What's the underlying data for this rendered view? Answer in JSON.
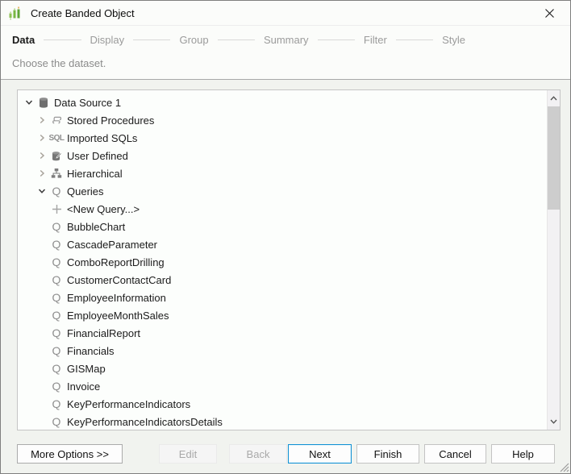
{
  "window": {
    "title": "Create Banded Object"
  },
  "wizard": {
    "steps": [
      {
        "label": "Data",
        "active": true
      },
      {
        "label": "Display",
        "active": false
      },
      {
        "label": "Group",
        "active": false
      },
      {
        "label": "Summary",
        "active": false
      },
      {
        "label": "Filter",
        "active": false
      },
      {
        "label": "Style",
        "active": false
      }
    ],
    "description": "Choose the dataset."
  },
  "tree": {
    "rows": [
      {
        "level": 0,
        "chevron": "expanded",
        "icon": "database",
        "label": "Data Source 1"
      },
      {
        "level": 1,
        "chevron": "collapsed",
        "icon": "stored-procedure",
        "label": "Stored Procedures"
      },
      {
        "level": 1,
        "chevron": "collapsed",
        "icon": "sql",
        "label": "Imported SQLs"
      },
      {
        "level": 1,
        "chevron": "collapsed",
        "icon": "user-defined",
        "label": "User Defined"
      },
      {
        "level": 1,
        "chevron": "collapsed",
        "icon": "hierarchy",
        "label": "Hierarchical"
      },
      {
        "level": 1,
        "chevron": "expanded",
        "icon": "query",
        "label": "Queries"
      },
      {
        "level": 2,
        "chevron": null,
        "icon": "plus",
        "label": "<New Query...>"
      },
      {
        "level": 2,
        "chevron": null,
        "icon": "query",
        "label": "BubbleChart"
      },
      {
        "level": 2,
        "chevron": null,
        "icon": "query",
        "label": "CascadeParameter"
      },
      {
        "level": 2,
        "chevron": null,
        "icon": "query",
        "label": "ComboReportDrilling"
      },
      {
        "level": 2,
        "chevron": null,
        "icon": "query",
        "label": "CustomerContactCard"
      },
      {
        "level": 2,
        "chevron": null,
        "icon": "query",
        "label": "EmployeeInformation"
      },
      {
        "level": 2,
        "chevron": null,
        "icon": "query",
        "label": "EmployeeMonthSales"
      },
      {
        "level": 2,
        "chevron": null,
        "icon": "query",
        "label": "FinancialReport"
      },
      {
        "level": 2,
        "chevron": null,
        "icon": "query",
        "label": "Financials"
      },
      {
        "level": 2,
        "chevron": null,
        "icon": "query",
        "label": "GISMap"
      },
      {
        "level": 2,
        "chevron": null,
        "icon": "query",
        "label": "Invoice"
      },
      {
        "level": 2,
        "chevron": null,
        "icon": "query",
        "label": "KeyPerformanceIndicators"
      },
      {
        "level": 2,
        "chevron": null,
        "icon": "query",
        "label": "KeyPerformanceIndicatorsDetails"
      }
    ]
  },
  "icon_glyphs": {
    "sql": "SQL",
    "query": "Q"
  },
  "buttons": {
    "more_options": {
      "label": "More Options >>",
      "enabled": true
    },
    "edit": {
      "label": "Edit",
      "enabled": false
    },
    "back": {
      "label": "Back",
      "enabled": false
    },
    "next": {
      "label": "Next",
      "enabled": true,
      "primary": true
    },
    "finish": {
      "label": "Finish",
      "enabled": true
    },
    "cancel": {
      "label": "Cancel",
      "enabled": true
    },
    "help": {
      "label": "Help",
      "enabled": true
    }
  },
  "colors": {
    "accent_green": "#76b943",
    "primary_blue": "#1292d4",
    "icon_gray": "#8f8f8f"
  }
}
